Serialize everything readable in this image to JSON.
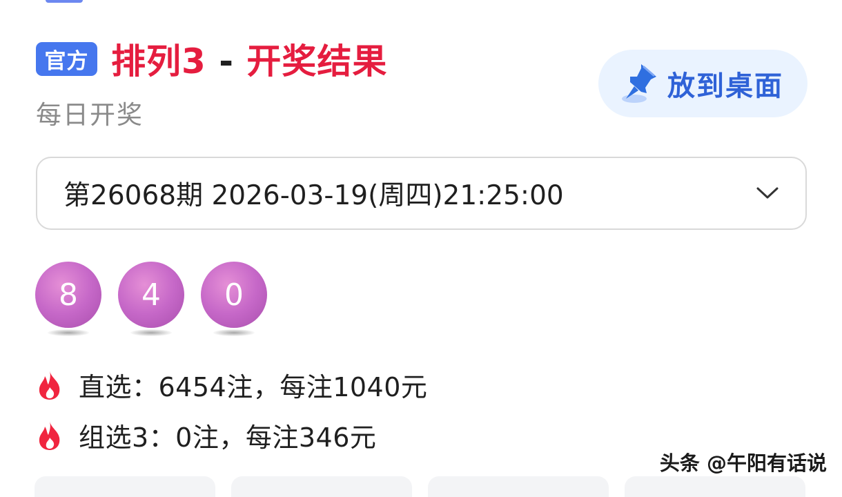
{
  "header": {
    "badge": "官方",
    "title_game": "排列3",
    "title_sep": " - ",
    "title_result": "开奖结果",
    "subtitle": "每日开奖"
  },
  "pin_button": {
    "label": "放到桌面",
    "icon": "pin-icon"
  },
  "draw_selector": {
    "selected": "第26068期 2026-03-19(周四)21:25:00",
    "icon": "chevron-down-icon"
  },
  "result": {
    "numbers": [
      "8",
      "4",
      "0"
    ],
    "ball_color": "#c668c8"
  },
  "prizes": [
    {
      "icon": "fire-icon",
      "text": "直选：6454注，每注1040元"
    },
    {
      "icon": "fire-icon",
      "text": "组选3：0注，每注346元"
    }
  ],
  "watermark": "头条 @午阳有话说",
  "colors": {
    "title_red": "#e51d3f",
    "badge_blue": "#4677ee",
    "pin_bg": "#eaf3ff",
    "pin_text": "#2f62d7"
  }
}
